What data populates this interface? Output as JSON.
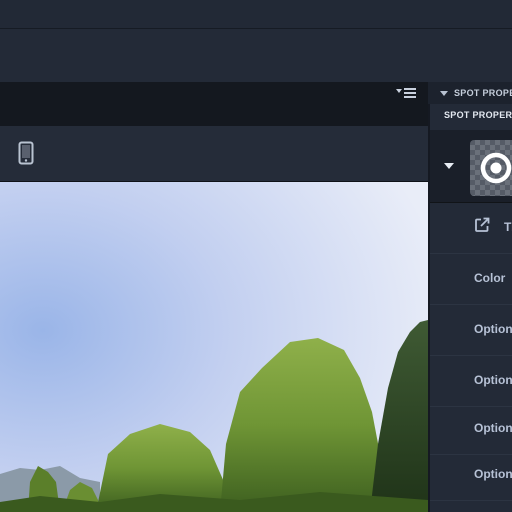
{
  "panel": {
    "collapsed_header": "SPOT PROPE",
    "title": "SPOT PROPERT",
    "rows": [
      {
        "label": "Ti",
        "icon": "external-link-icon"
      },
      {
        "label": "Color"
      },
      {
        "label": "Option"
      },
      {
        "label": "Option"
      },
      {
        "label": "Option"
      },
      {
        "label": "Option"
      }
    ]
  },
  "icons": {
    "list_menu": "list-menu-icon",
    "phone": "mobile-device-icon",
    "spot": "target-spot-icon"
  },
  "colors": {
    "background": "#1f2633",
    "panel": "#232a37",
    "dark_bar": "#14181f",
    "label": "#b7c2d6"
  }
}
